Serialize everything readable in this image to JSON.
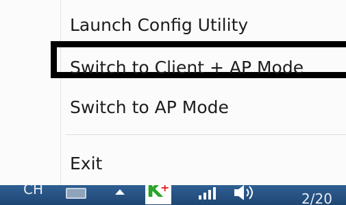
{
  "context_menu": {
    "items": [
      {
        "label": "Launch Config Utility"
      },
      {
        "label": "Switch to Client + AP Mode",
        "highlighted": true
      },
      {
        "label": "Switch to AP Mode"
      },
      {
        "label": "Exit"
      }
    ]
  },
  "taskbar": {
    "language": "CH",
    "tray_icons": [
      "keyboard-icon",
      "show-hidden-icons-arrow",
      "k-plus-wifi-utility-icon",
      "network-signal-icon",
      "speaker-icon"
    ],
    "clock_partial": "2/20"
  },
  "colors": {
    "menu_background": "#fbfbfb",
    "highlight_border": "#000000",
    "taskbar": "#2a5688",
    "k_icon_green": "#2aa42a",
    "k_icon_red": "#e22020"
  }
}
